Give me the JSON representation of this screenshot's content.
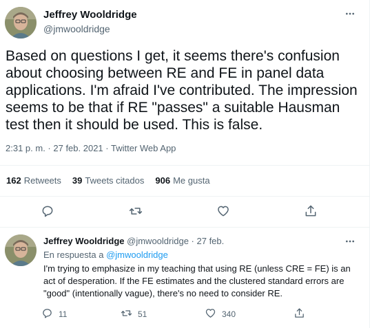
{
  "tweet": {
    "name": "Jeffrey Wooldridge",
    "handle": "@jmwooldridge",
    "text": "Based on questions I get, it seems there's confusion about choosing between RE and FE in panel data applications. I'm afraid I've contributed. The impression seems to be that if RE \"passes\" a suitable Hausman test then it should be used. This is false.",
    "time": "2:31 p. m.",
    "sep1": " · ",
    "date": "27 feb. 2021",
    "sep2": " · ",
    "source": "Twitter Web App",
    "stats": {
      "retweets_count": "162",
      "retweets_label": "Retweets",
      "quotes_count": "39",
      "quotes_label": "Tweets citados",
      "likes_count": "906",
      "likes_label": "Me gusta"
    }
  },
  "reply": {
    "name": "Jeffrey Wooldridge",
    "handle": "@jmwooldridge",
    "date": "27 feb.",
    "dot": " · ",
    "in_reply_label": "En respuesta a ",
    "in_reply_handle": "@jmwooldridge",
    "text": "I'm trying to emphasize in my teaching that using RE (unless CRE = FE) is an act of desperation. If the FE estimates and the clustered standard errors are \"good\" (intentionally vague), there's no need to consider RE.",
    "replies": "11",
    "retweets": "51",
    "likes": "340"
  },
  "icons": {
    "more": "more-horizontal-icon",
    "reply": "comment-icon",
    "retweet": "retweet-icon",
    "like": "heart-icon",
    "share": "share-icon"
  },
  "colors": {
    "text": "#0f1419",
    "secondary": "#536471",
    "link": "#1d9bf0",
    "divider": "#eff3f4"
  }
}
